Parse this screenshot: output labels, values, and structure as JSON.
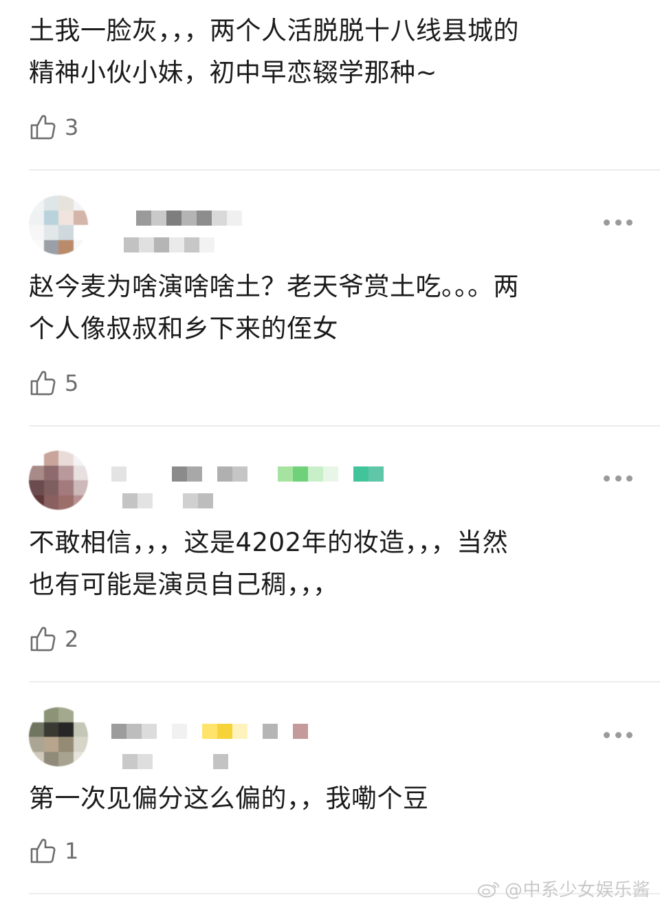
{
  "comments": [
    {
      "text_lines": [
        "土我一脸灰，，，两个人活脱脱十八线县城的",
        "精神小伙小妹，初中早恋辍学那种~"
      ],
      "likes": "3"
    },
    {
      "text_lines": [
        "赵今麦为啥演啥啥土？老天爷赏土吃。。。两",
        "个人像叔叔和乡下来的侄女"
      ],
      "likes": "5"
    },
    {
      "text_lines": [
        "不敢相信，，，这是4202年的妆造，，，当然",
        "也有可能是演员自己稠，，，"
      ],
      "likes": "2"
    },
    {
      "text_lines": [
        "第一次见偏分这么偏的，，我嘞个豆"
      ],
      "likes": "1"
    }
  ],
  "watermark": {
    "text": "@中系少女娱乐酱",
    "icon": "weibo-icon"
  },
  "icons": {
    "like": "thumbs-up-icon",
    "more": "more-dots-icon"
  },
  "colors": {
    "text": "#1b1b1b",
    "meta": "#6b6b6b",
    "divider": "#ececec",
    "dots": "#9a9a9a"
  }
}
